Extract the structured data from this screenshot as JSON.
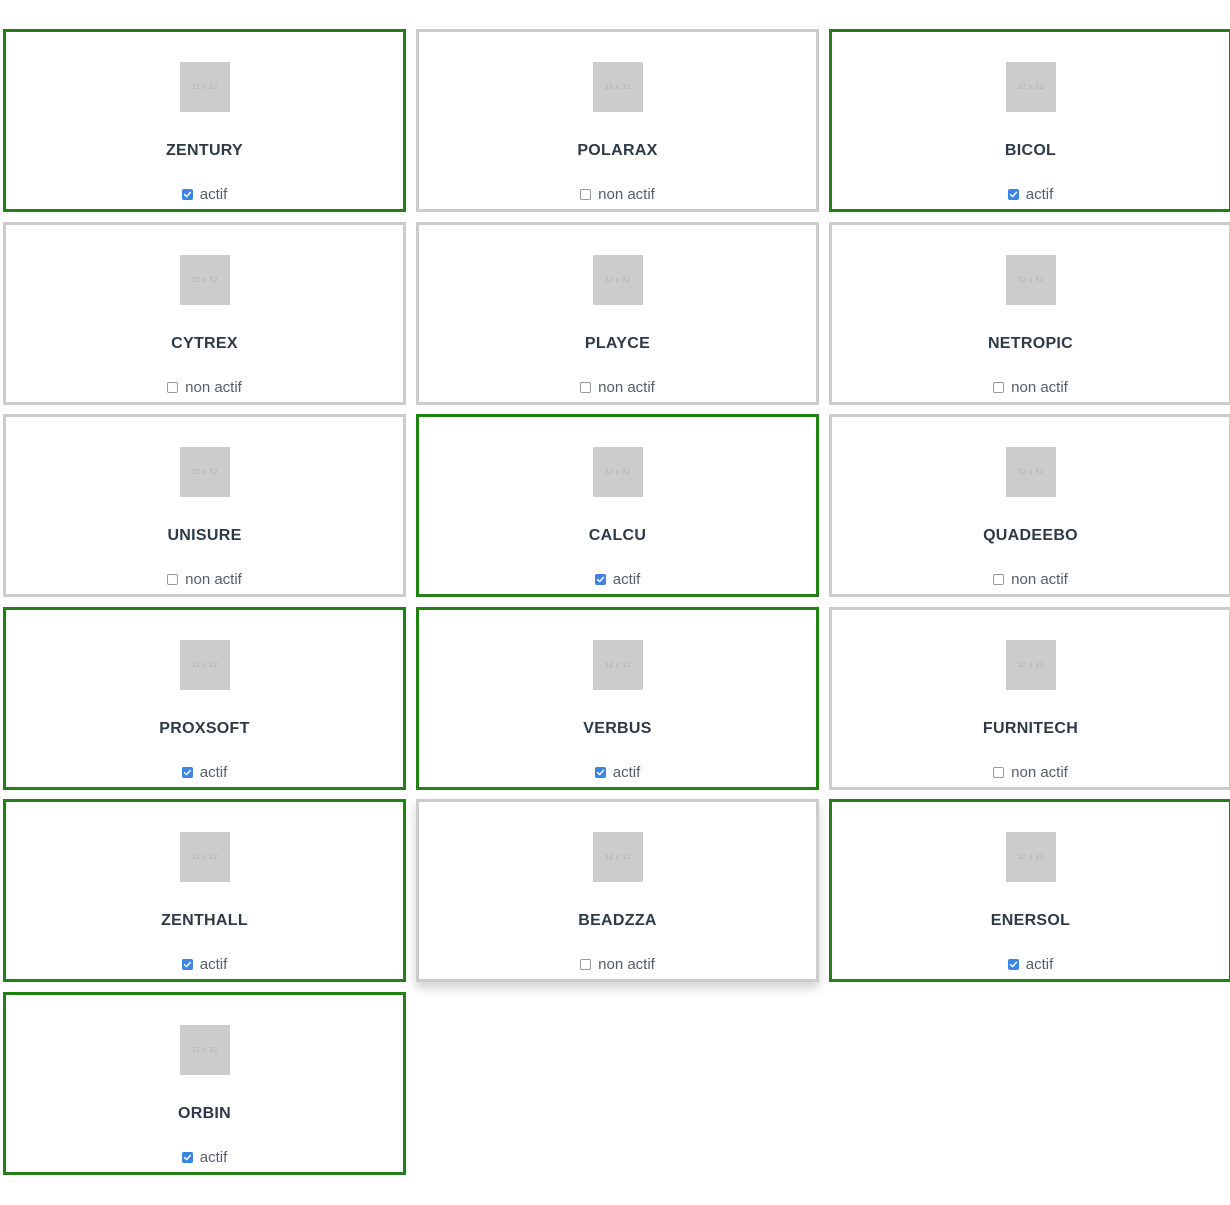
{
  "logo_placeholder": "32 x 32",
  "colors": {
    "active_border": "#238016",
    "inactive_border": "#cccccc",
    "checkbox_checked": "#3b86e3"
  },
  "companies": [
    {
      "name": "ZENTURY",
      "status": "actif",
      "active": true
    },
    {
      "name": "POLARAX",
      "status": "non actif",
      "active": false
    },
    {
      "name": "BICOL",
      "status": "actif",
      "active": true
    },
    {
      "name": "CYTREX",
      "status": "non actif",
      "active": false
    },
    {
      "name": "PLAYCE",
      "status": "non actif",
      "active": false
    },
    {
      "name": "NETROPIC",
      "status": "non actif",
      "active": false
    },
    {
      "name": "UNISURE",
      "status": "non actif",
      "active": false
    },
    {
      "name": "CALCU",
      "status": "actif",
      "active": true
    },
    {
      "name": "QUADEEBO",
      "status": "non actif",
      "active": false
    },
    {
      "name": "PROXSOFT",
      "status": "actif",
      "active": true
    },
    {
      "name": "VERBUS",
      "status": "actif",
      "active": true
    },
    {
      "name": "FURNITECH",
      "status": "non actif",
      "active": false
    },
    {
      "name": "ZENTHALL",
      "status": "actif",
      "active": true
    },
    {
      "name": "BEADZZA",
      "status": "non actif",
      "active": false,
      "hovered": true
    },
    {
      "name": "ENERSOL",
      "status": "actif",
      "active": true
    },
    {
      "name": "ORBIN",
      "status": "actif",
      "active": true
    }
  ]
}
